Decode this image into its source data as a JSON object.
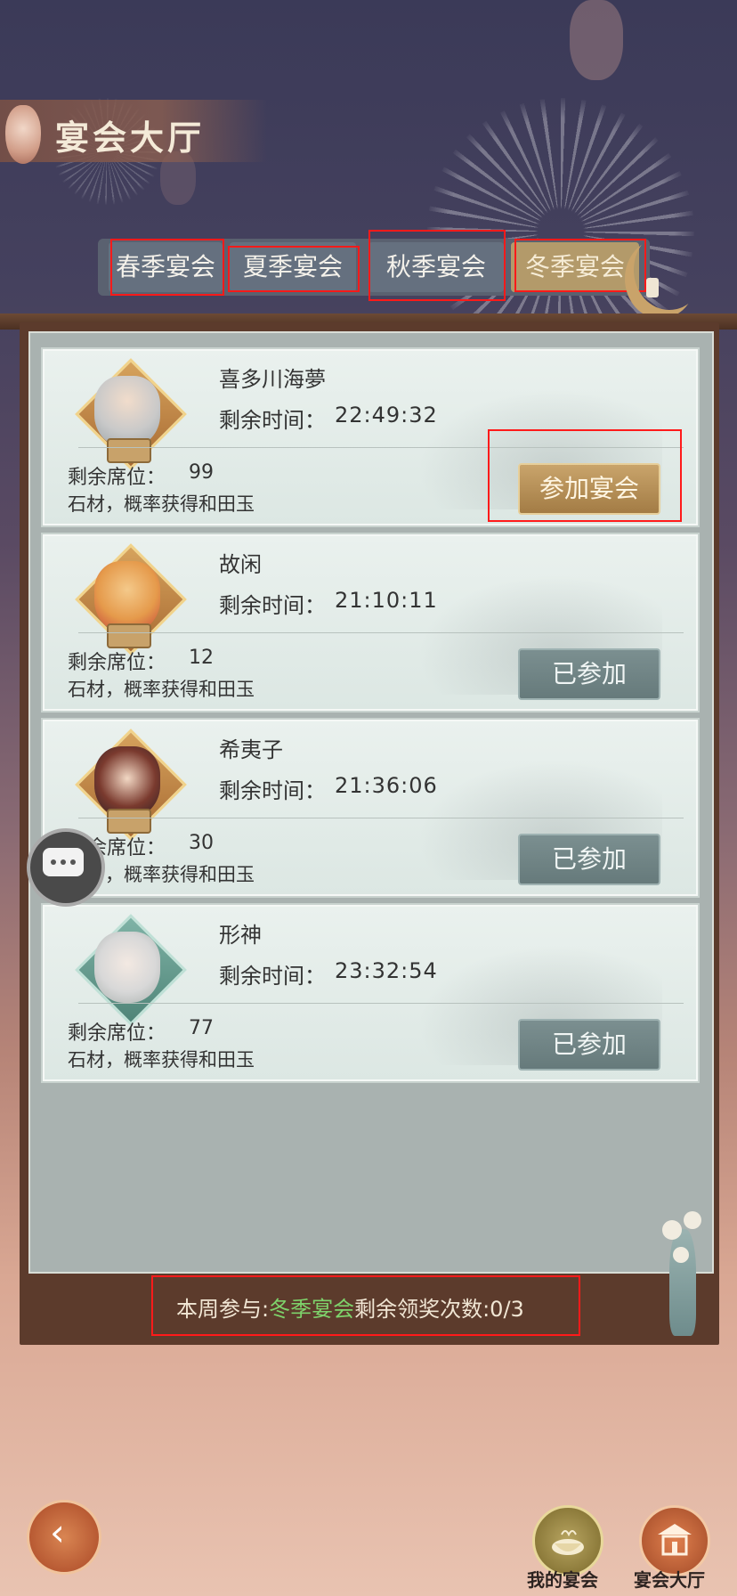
{
  "header": {
    "title": "宴会大厅"
  },
  "tabs": [
    {
      "label": "春季宴会",
      "active": false
    },
    {
      "label": "夏季宴会",
      "active": false
    },
    {
      "label": "秋季宴会",
      "active": false
    },
    {
      "label": "冬季宴会",
      "active": true
    }
  ],
  "labels": {
    "time": "剩余时间：",
    "seats": "剩余席位：",
    "reward": "石材，概率获得和田玉"
  },
  "banquets": [
    {
      "host": "喜多川海夢",
      "time": "22:49:32",
      "seats": "99",
      "button": "参加宴会",
      "joined": false
    },
    {
      "host": "故闲",
      "time": "21:10:11",
      "seats": "12",
      "button": "已参加",
      "joined": true
    },
    {
      "host": "希夷子",
      "time": "21:36:06",
      "seats": "30",
      "button": "已参加",
      "joined": true
    },
    {
      "host": "形神",
      "time": "23:32:54",
      "seats": "77",
      "button": "已参加",
      "joined": true
    }
  ],
  "footer": {
    "prefix": "本周参与:",
    "season": "冬季宴会",
    "suffix": "剩余领奖次数:0/3"
  },
  "nav": {
    "my_banquet": "我的宴会",
    "banquet_hall": "宴会大厅"
  },
  "colors": {
    "accent_gold": "#b39a6a",
    "highlight_green": "#7ed36b",
    "frame_wood": "#5c3b2c"
  }
}
